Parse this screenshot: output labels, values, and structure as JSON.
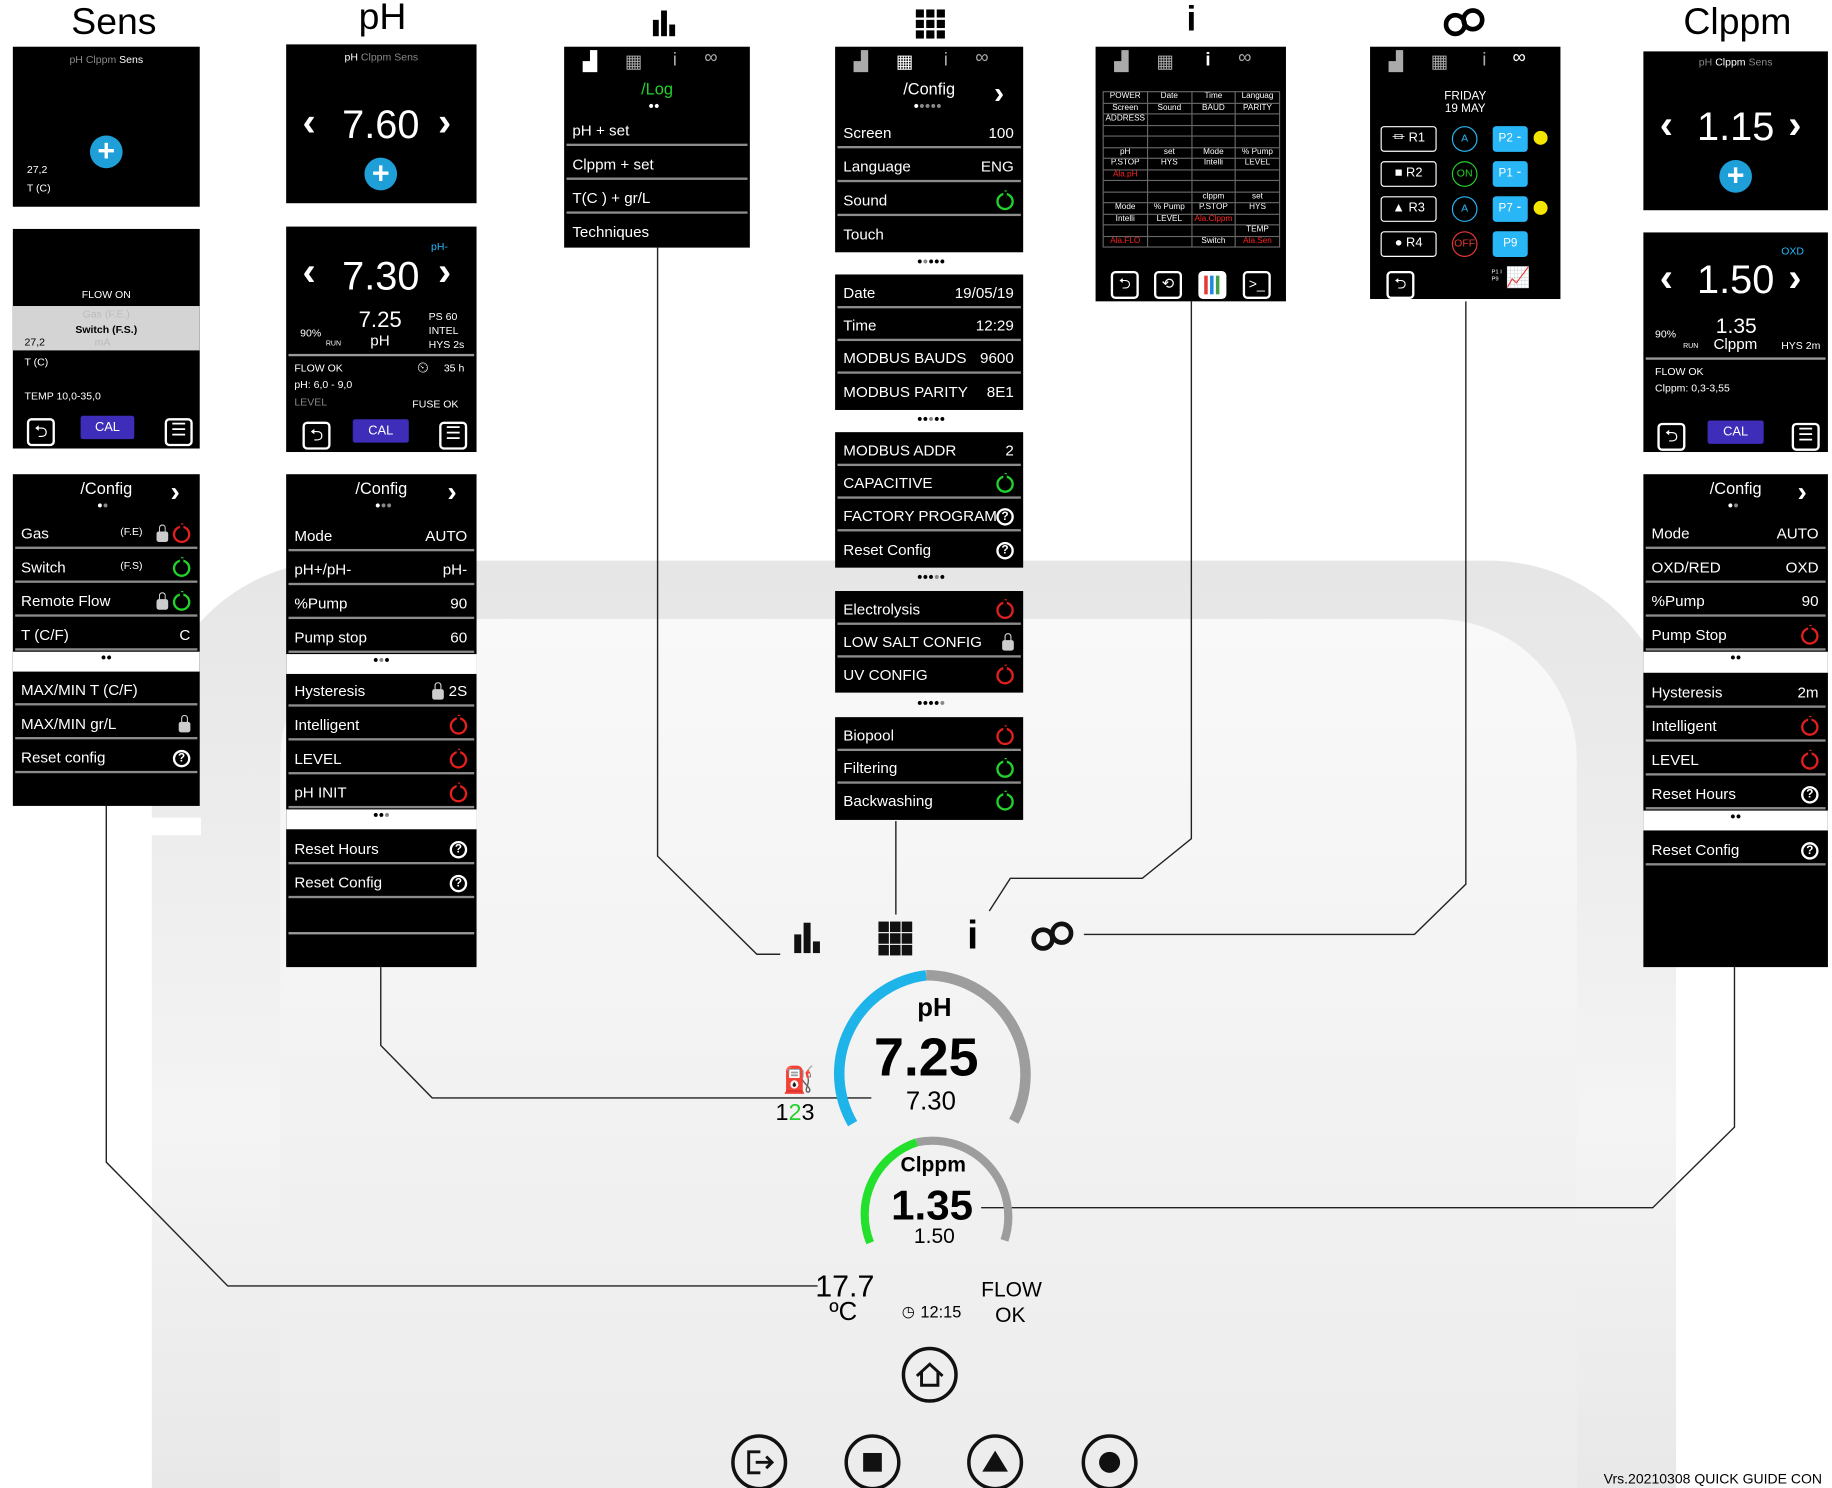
{
  "titles": {
    "sens": "Sens",
    "ph": "pH",
    "log_icon": "log-icon",
    "config_icon": "grid-icon",
    "info": "i",
    "clppm": "Clppm",
    "oo": "∞"
  },
  "tabs": {
    "ph": "pH",
    "clppm": "Clppm",
    "sens": "Sens"
  },
  "sens": {
    "s1": {
      "t1": "27,2",
      "t2": "T (C)"
    },
    "s2": {
      "flow": "FLOW ON",
      "gas": "Gas (F.E.)",
      "switch": "Switch (F.S.)",
      "t": "27,2",
      "tc": "T (C)",
      "mA": "mA",
      "temp": "TEMP 10,0-35,0",
      "cal": "CAL"
    },
    "config": {
      "title": "/Config",
      "rows": [
        {
          "l": "Gas",
          "m": "(F.E)"
        },
        {
          "l": "Switch",
          "m": "(F.S)"
        },
        {
          "l": "Remote Flow"
        },
        {
          "l": "T (C/F)",
          "r": "C"
        }
      ],
      "rows2": [
        "MAX/MIN T (C/F)",
        "MAX/MIN gr/L",
        "Reset config"
      ]
    }
  },
  "ph": {
    "p1": {
      "val": "7.60"
    },
    "p2": {
      "val": "7.30",
      "tag": "pH-",
      "pct": "90%",
      "run": "RUN",
      "v2": "7.25",
      "unit": "pH",
      "ps": "PS 60",
      "intel": "INTEL",
      "hys": "HYS 2s",
      "flow": "FLOW OK",
      "range": "pH: 6,0 - 9,0",
      "hours": "35 h",
      "level": "LEVEL",
      "fuse": "FUSE OK",
      "cal": "CAL"
    },
    "config": {
      "title": "/Config",
      "rows": [
        {
          "l": "Mode",
          "r": "AUTO"
        },
        {
          "l": "pH+/pH-",
          "r": "pH-"
        },
        {
          "l": "%Pump",
          "r": "90"
        },
        {
          "l": "Pump stop",
          "r": "60"
        }
      ],
      "rows2": [
        {
          "l": "Hysteresis",
          "r": "2S"
        },
        {
          "l": "Intelligent"
        },
        {
          "l": "LEVEL"
        },
        {
          "l": "pH INIT"
        }
      ],
      "rows3": [
        "Reset Hours",
        "Reset Config"
      ]
    }
  },
  "log": {
    "title": "/Log",
    "rows": [
      "pH + set",
      "Clppm + set",
      "T(C ) + gr/L",
      "Techniques"
    ]
  },
  "cfg": {
    "title": "/Config",
    "g1": [
      {
        "l": "Screen",
        "r": "100"
      },
      {
        "l": "Language",
        "r": "ENG"
      },
      {
        "l": "Sound"
      },
      {
        "l": "Touch"
      }
    ],
    "g2": [
      {
        "l": "Date",
        "r": "19/05/19"
      },
      {
        "l": "Time",
        "r": "12:29"
      },
      {
        "l": "MODBUS BAUDS",
        "r": "9600"
      },
      {
        "l": "MODBUS PARITY",
        "r": "8E1"
      }
    ],
    "g3": [
      {
        "l": "MODBUS ADDR",
        "r": "2"
      },
      {
        "l": "CAPACITIVE"
      },
      {
        "l": "FACTORY PROGRAM"
      },
      {
        "l": "Reset Config"
      }
    ],
    "g4": [
      "Electrolysis",
      "LOW SALT CONFIG",
      "UV CONFIG"
    ],
    "g5": [
      "Biopool",
      "Filtering",
      "Backwashing"
    ]
  },
  "info": {
    "grid": [
      [
        "POWER",
        "Date",
        "Time",
        "Languag"
      ],
      [
        "Screen",
        "Sound",
        "BAUD",
        "PARITY"
      ],
      [
        "ADDRESS",
        "",
        "",
        ""
      ],
      [
        "",
        "",
        "",
        ""
      ],
      [
        "",
        "",
        "",
        ""
      ],
      [
        "pH",
        "set",
        "Mode",
        "% Pump"
      ],
      [
        "P.STOP",
        "HYS",
        "Intelli",
        "LEVEL"
      ],
      [
        "Ala.pH",
        "",
        "",
        ""
      ],
      [
        "",
        "",
        "",
        ""
      ],
      [
        "",
        "",
        "clppm",
        "set"
      ],
      [
        "Mode",
        "% Pump",
        "P.STOP",
        "HYS"
      ],
      [
        "Intelli",
        "LEVEL",
        "Ala.Clppm",
        ""
      ],
      [
        "",
        "",
        "",
        "TEMP"
      ],
      [
        "Ala.FLO",
        "",
        "Switch",
        "Ala.Sen"
      ]
    ]
  },
  "relays": {
    "day": "FRIDAY",
    "date": "19 MAY",
    "rows": [
      {
        "r": "R1",
        "m": "A",
        "p": "P2"
      },
      {
        "r": "R2",
        "m": "ON",
        "p": "P1"
      },
      {
        "r": "R3",
        "m": "A",
        "p": "P7"
      },
      {
        "r": "R4",
        "m": "OFF",
        "p": "P9"
      }
    ],
    "pp": "P1 I P9"
  },
  "cl": {
    "c1": {
      "val": "1.15"
    },
    "c2": {
      "val": "1.50",
      "tag": "OXD",
      "pct": "90%",
      "run": "RUN",
      "v2": "1.35",
      "unit": "Clppm",
      "hys": "HYS 2m",
      "flow": "FLOW OK",
      "range": "Clppm: 0,3-3,55",
      "cal": "CAL"
    },
    "config": {
      "title": "/Config",
      "rows": [
        {
          "l": "Mode",
          "r": "AUTO"
        },
        {
          "l": "OXD/RED",
          "r": "OXD"
        },
        {
          "l": "%Pump",
          "r": "90"
        },
        {
          "l": "Pump Stop"
        }
      ],
      "rows2": [
        {
          "l": "Hysteresis",
          "r": "2m"
        },
        {
          "l": "Intelligent"
        },
        {
          "l": "LEVEL"
        },
        {
          "l": "Reset Hours"
        }
      ],
      "rows3": [
        "Reset Config"
      ]
    }
  },
  "main": {
    "ph_label": "pH",
    "ph_val": "7.25",
    "ph_set": "7.30",
    "cl_label": "Clppm",
    "cl_val": "1.35",
    "cl_set": "1.50",
    "temp": "17.7",
    "temp_unit": "ºC",
    "time": "12:15",
    "flow": "FLOW",
    "ok": "OK",
    "count1": "1",
    "count2": "2",
    "count3": "3"
  },
  "footer": "Vrs.20210308 QUICK GUIDE CON"
}
